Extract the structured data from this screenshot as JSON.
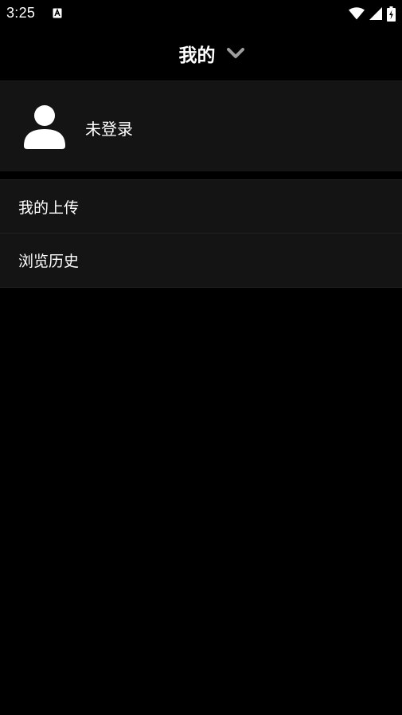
{
  "status_bar": {
    "time": "3:25",
    "icons": [
      "a-icon",
      "wifi-icon",
      "signal-icon",
      "battery-charging-icon"
    ]
  },
  "header": {
    "title": "我的",
    "dropdown_icon": "chevron-down-icon"
  },
  "profile": {
    "avatar_icon": "user-icon",
    "login_status": "未登录"
  },
  "menu": {
    "items": [
      {
        "label": "我的上传"
      },
      {
        "label": "浏览历史"
      }
    ]
  },
  "colors": {
    "background": "#000000",
    "card": "#141414",
    "divider": "#222222",
    "text": "#ffffff",
    "chevron": "#9e9e9e"
  }
}
